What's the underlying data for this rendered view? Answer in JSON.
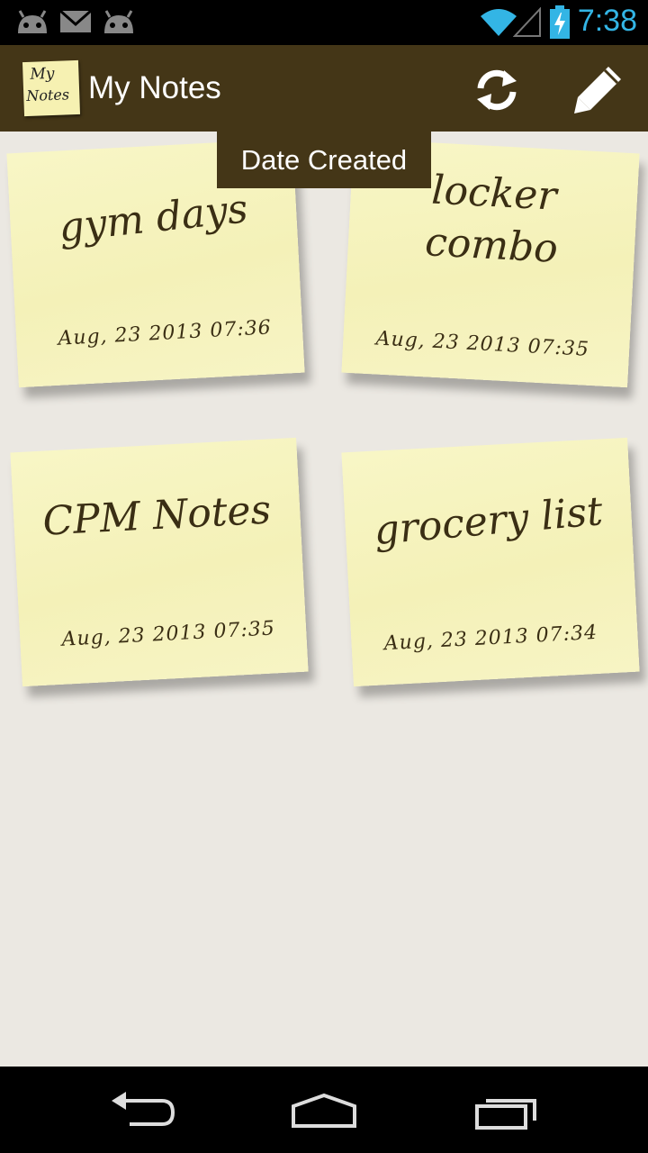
{
  "status_bar": {
    "time": "7:38",
    "icons": [
      "android-notification-icon",
      "mail-icon",
      "android-notification-icon",
      "wifi-icon",
      "signal-icon",
      "battery-charging-icon"
    ],
    "accent_color": "#33b5e5"
  },
  "action_bar": {
    "logo_text_line1": "My",
    "logo_text_line2": "Notes",
    "title": "My Notes",
    "actions": [
      "refresh-icon",
      "pencil-icon"
    ],
    "background_color": "#443617"
  },
  "sort_tooltip": {
    "label": "Date Created"
  },
  "notes": [
    {
      "title": "gym days",
      "date": "Aug, 23 2013 07:36"
    },
    {
      "title_line1": "locker",
      "title_line2": "combo",
      "date": "Aug, 23 2013 07:35"
    },
    {
      "title": "CPM Notes",
      "date": "Aug, 23 2013 07:35"
    },
    {
      "title": "grocery list",
      "date": "Aug, 23 2013 07:34"
    }
  ],
  "nav_bar": {
    "buttons": [
      "back-icon",
      "home-icon",
      "recent-apps-icon"
    ]
  }
}
